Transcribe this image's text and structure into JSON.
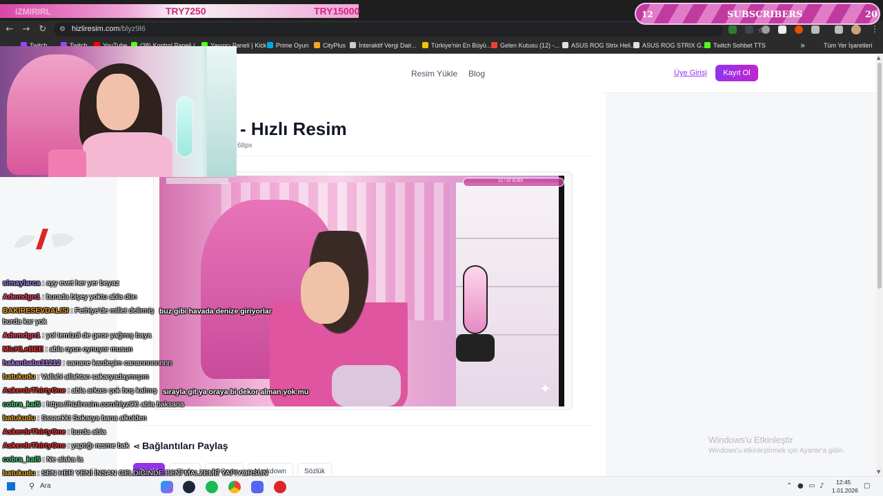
{
  "browser": {
    "url_domain": "hizliresim.com",
    "url_path": "/blyz9l6",
    "bookmarks": [
      {
        "label": "Twitch",
        "color": "#9146ff"
      },
      {
        "label": "Twitch",
        "color": "#9146ff"
      },
      {
        "label": "YouTube",
        "color": "#ff0000"
      },
      {
        "label": "(38) Kontrol Paneli /...",
        "color": "#53fc18"
      },
      {
        "label": "Yayıncı Paneli | Kick",
        "color": "#53fc18"
      },
      {
        "label": "Prime Oyun",
        "color": "#00a8e1"
      },
      {
        "label": "CityPlus",
        "color": "#f5a623"
      },
      {
        "label": "İnteraktif Vergi Dair...",
        "color": "#cccccc"
      },
      {
        "label": "Türkiye'nin En Büyü...",
        "color": "#f2c200"
      },
      {
        "label": "Gelen Kutusu (12) -...",
        "color": "#ea4335"
      },
      {
        "label": "ASUS ROG Strix Heli...",
        "color": "#e0e0e0"
      },
      {
        "label": "ASUS ROG STRIX G...",
        "color": "#e0e0e0"
      },
      {
        "label": "Twitch Sohbet TTS",
        "color": "#53fc18"
      }
    ],
    "all_bookmarks": "Tüm Yer İşaretleri"
  },
  "overlay": {
    "top_bar": {
      "label": "IZMIRIRL",
      "current": "TRY7250",
      "target": "TRY15000"
    },
    "sub_goal": {
      "current": "12",
      "label": "SUBSCRIBERS",
      "target": "20",
      "progress": 0.6
    }
  },
  "site": {
    "nav": {
      "upload": "Resim Yükle",
      "blog": "Blog",
      "login": "Üye Girişi",
      "register": "Kayıt Ol"
    },
    "title": "- Hızlı Resim",
    "meta": "68px",
    "share": {
      "title": "Bağlantıları Paylaş",
      "tabs": [
        "Direkt",
        "Sayfa",
        "BBCode",
        "Markdown",
        "Sözlük"
      ]
    }
  },
  "stream_shot": {
    "sub_goal_text": "12 / 20 SUBS"
  },
  "captions": {
    "line1": "buz gibi havada denize giriyorlar",
    "line2": "sırayla git ya oraya bi dekor alman yok mu"
  },
  "chat": [
    {
      "user": "simaylarca",
      "color": "#a78bfa",
      "text": ": ayy evet her yer beyaz"
    },
    {
      "user": "Ademdgn1",
      "color": "#ff4d6d",
      "text": ": burada bişey yoktu abla dün"
    },
    {
      "user": "BAKIRESEVDALISI",
      "color": "#f5a623",
      "text": ": Fethiye'de millet delirmiş"
    },
    {
      "user": "",
      "color": "#ffffff",
      "text": "burda kar yok"
    },
    {
      "user": "Ademdgn1",
      "color": "#ff4d6d",
      "text": ": yol temizdi de gece yağmış baya"
    },
    {
      "user": "MicHLeBEE",
      "color": "#ff3b3b",
      "text": ": abla oyun oynuyor musun"
    },
    {
      "user": "hakanbaba31212",
      "color": "#c084fc",
      "text": ": sanane kardeşim canannnnnnnn"
    },
    {
      "user": "batukudu",
      "color": "#f0b429",
      "text": ": Vallahi allahtan sakaryadaymışım"
    },
    {
      "user": "AskerdeThirtyOne",
      "color": "#ff3b3b",
      "text": ": abla arkası çok boş kalmış"
    },
    {
      "user": "cobra_kai5",
      "color": "#4ade80",
      "text": ": https://hizliresim.com/blyz9l6 abla baksana"
    },
    {
      "user": "batukudu",
      "color": "#f0b429",
      "text": ": Sssaekkt Sakarya bana alkolden"
    },
    {
      "user": "AskerdeThirtyOne",
      "color": "#ff3b3b",
      "text": ": burda abla"
    },
    {
      "user": "AskerdeThirtyOne",
      "color": "#ff3b3b",
      "text": ": yaptığı resme bak"
    },
    {
      "user": "cobra_kai5",
      "color": "#4ade80",
      "text": ": Ne alaka la"
    },
    {
      "user": "batukudu",
      "color": "#f0b429",
      "text": ": SEN HER YENİ İNSAN GELDİĞİNDE BENİ MALZEME YAPIYORSUN"
    }
  ],
  "windows": {
    "activate_title": "Windows'u Etkinleştir",
    "activate_sub": "Windows'u etkinleştirmek için Ayarlar'a gidin."
  },
  "taskbar": {
    "search": "Ara",
    "time": "12:45",
    "date": "1.01.2026"
  }
}
